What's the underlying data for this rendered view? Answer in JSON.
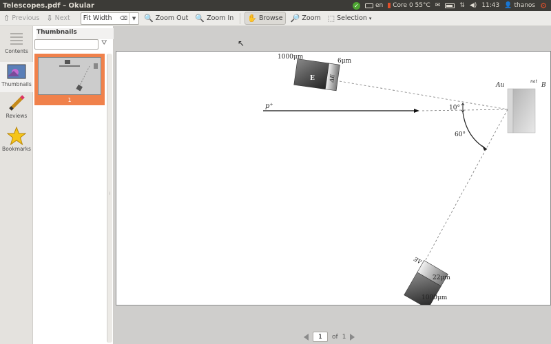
{
  "window": {
    "title": "Telescopes.pdf – Okular"
  },
  "tray": {
    "keyboard": "en",
    "cpu": "Core 0 55°C",
    "time": "11:43",
    "user": "thanos"
  },
  "toolbar": {
    "previous": "Previous",
    "next": "Next",
    "zoom_mode": "Fit Width",
    "zoom_out": "Zoom Out",
    "zoom_in": "Zoom In",
    "browse": "Browse",
    "zoom": "Zoom",
    "selection": "Selection"
  },
  "sidebar": {
    "items": [
      {
        "label": "Contents",
        "icon": "contents-icon"
      },
      {
        "label": "Thumbnails",
        "icon": "thumbnails-icon"
      },
      {
        "label": "Reviews",
        "icon": "pencil-icon"
      },
      {
        "label": "Bookmarks",
        "icon": "star-icon"
      }
    ]
  },
  "thumbnails": {
    "title": "Thumbnails",
    "filter_placeholder": "",
    "page_label": "1"
  },
  "pager": {
    "current": "1",
    "of_label": "of",
    "total": "1"
  },
  "figure": {
    "det1_big": "E",
    "det1_thin": "ΔE",
    "det1_big_size": "1000μm",
    "det1_thin_size": "6μm",
    "det2_big": "E",
    "det2_thin": "ΔE",
    "det2_thin_size": "22μm",
    "det2_big_size": "1000μm",
    "beam": "p⁺",
    "angle1": "10°",
    "angle2": "60°",
    "target_left": "Au",
    "target_right": "B",
    "target_right_sup": "nat"
  },
  "colors": {
    "accent": "#f0814b",
    "topbar": "#3c3b37",
    "document_bg": "#cfcecc"
  }
}
